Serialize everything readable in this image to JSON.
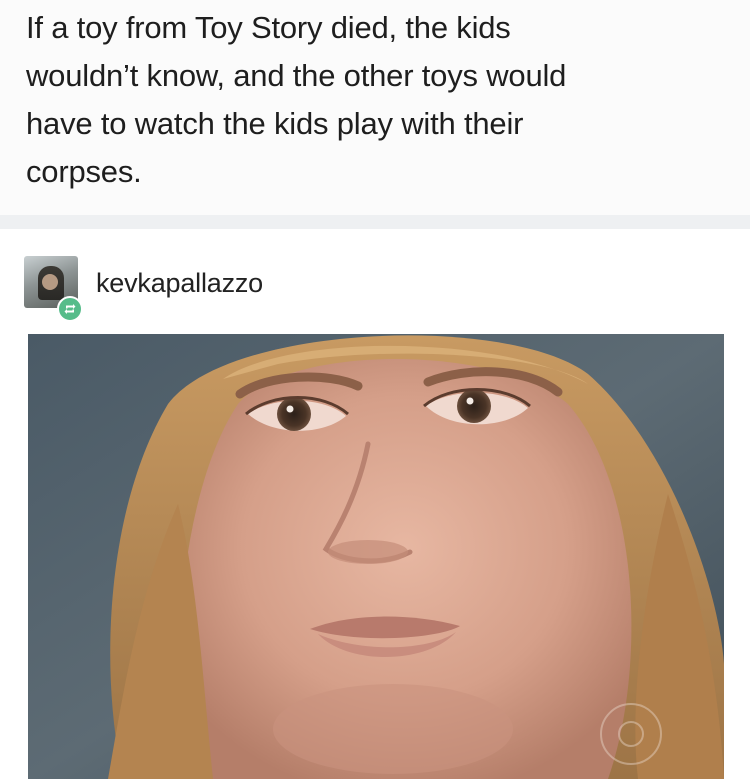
{
  "post": {
    "text_lines": [
      "If a toy from Toy Story died, the kids",
      "wouldn’t know, and the other toys would",
      "have to watch the kids play with their",
      "corpses."
    ]
  },
  "reblog": {
    "username": "kevkapallazzo",
    "avatar_icon": "user-avatar",
    "badge_icon": "reblog-icon",
    "badge_color": "#56bc8a"
  },
  "image": {
    "subject": "reaction-photo"
  }
}
